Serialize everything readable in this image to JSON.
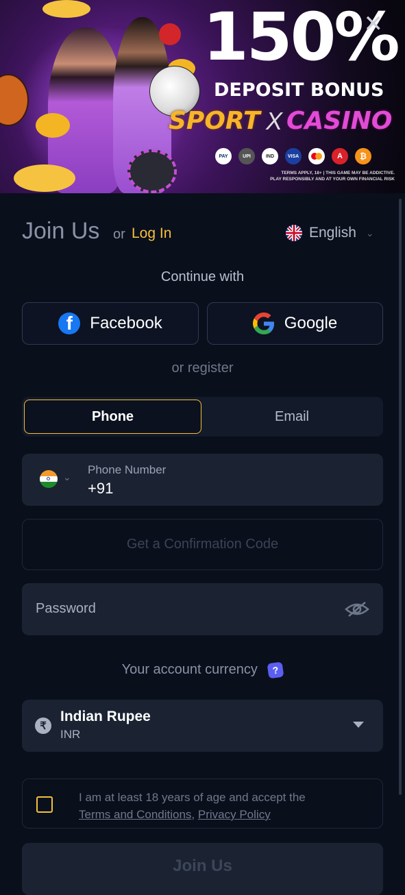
{
  "banner": {
    "headline": "150%",
    "subheadline": "DEPOSIT BONUS",
    "sport": "SPORT",
    "x_mark": "X",
    "casino": "CASINO",
    "close_glyph": "✕",
    "terms_line1": "TERMS APPLY, 18+ | THIS GAME MAY BE ADDICTIVE.",
    "terms_line2": "PLAY RESPONSIBLY AND AT YOUR OWN FINANCIAL RISK",
    "payment_icons": [
      "paytm-icon",
      "upi-icon",
      "imps-icon",
      "visa-icon",
      "mastercard-icon",
      "astropay-icon",
      "bitcoin-icon"
    ]
  },
  "header": {
    "title": "Join Us",
    "or": "or",
    "login": "Log In",
    "language": "English"
  },
  "social": {
    "continue_with": "Continue with",
    "facebook": "Facebook",
    "google": "Google",
    "or_register": "or register"
  },
  "tabs": {
    "phone": "Phone",
    "email": "Email",
    "active": "Phone"
  },
  "form": {
    "phone_label": "Phone Number",
    "phone_value": "+91",
    "code_button": "Get a Confirmation Code",
    "password_placeholder": "Password",
    "currency_label": "Your account currency",
    "currency_name": "Indian Rupee",
    "currency_code": "INR",
    "currency_symbol": "₹",
    "agree_prefix": "I am at least 18 years of age and accept the",
    "terms_link": "Terms and Conditions",
    "comma": ",",
    "privacy_link": "Privacy Policy",
    "submit": "Join Us"
  },
  "colors": {
    "accent": "#f5c13c",
    "background": "#0a0f1c",
    "field": "#1b2333"
  }
}
